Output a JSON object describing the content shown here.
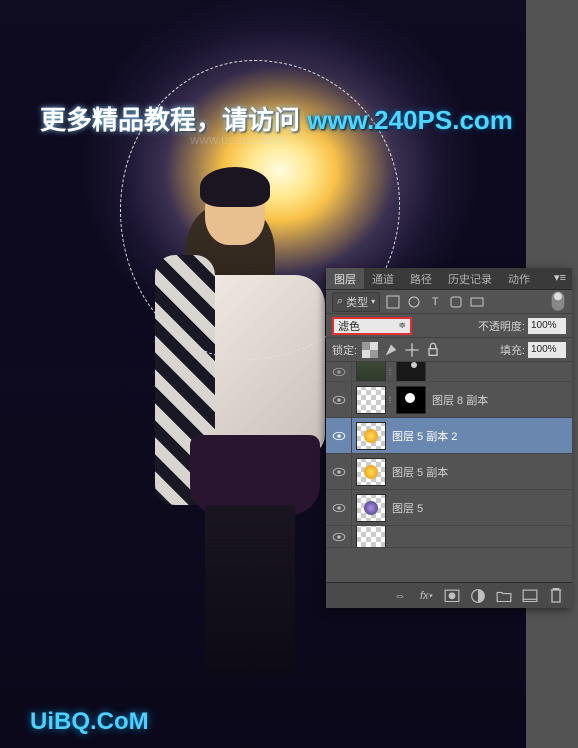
{
  "promo": {
    "zh": "更多精品教程，请访问 ",
    "url": "www.240PS.com"
  },
  "watermarks": {
    "small": "www.psanz.com",
    "bottom": "UiBQ.CoM"
  },
  "panel": {
    "tabs": [
      "图层",
      "通道",
      "路径",
      "历史记录",
      "动作"
    ],
    "active_tab": 0,
    "filter": {
      "kind_label": "类型",
      "search_icon": "⌕"
    },
    "blend": {
      "mode": "滤色",
      "opacity_label": "不透明度:",
      "opacity_value": "100%"
    },
    "lock": {
      "label": "锁定:",
      "fill_label": "填充:",
      "fill_value": "100%"
    },
    "layers": [
      {
        "visible": true,
        "name": "图层 8 副本",
        "thumb": "checker",
        "mask": "black-dot"
      },
      {
        "visible": true,
        "name": "图层 5 副本 2",
        "thumb": "yellow",
        "selected": true
      },
      {
        "visible": true,
        "name": "图层 5 副本",
        "thumb": "yellow"
      },
      {
        "visible": true,
        "name": "图层 5",
        "thumb": "purple"
      }
    ],
    "footer_icons": [
      "link",
      "fx",
      "mask",
      "adjust",
      "folder",
      "new",
      "trash"
    ]
  }
}
